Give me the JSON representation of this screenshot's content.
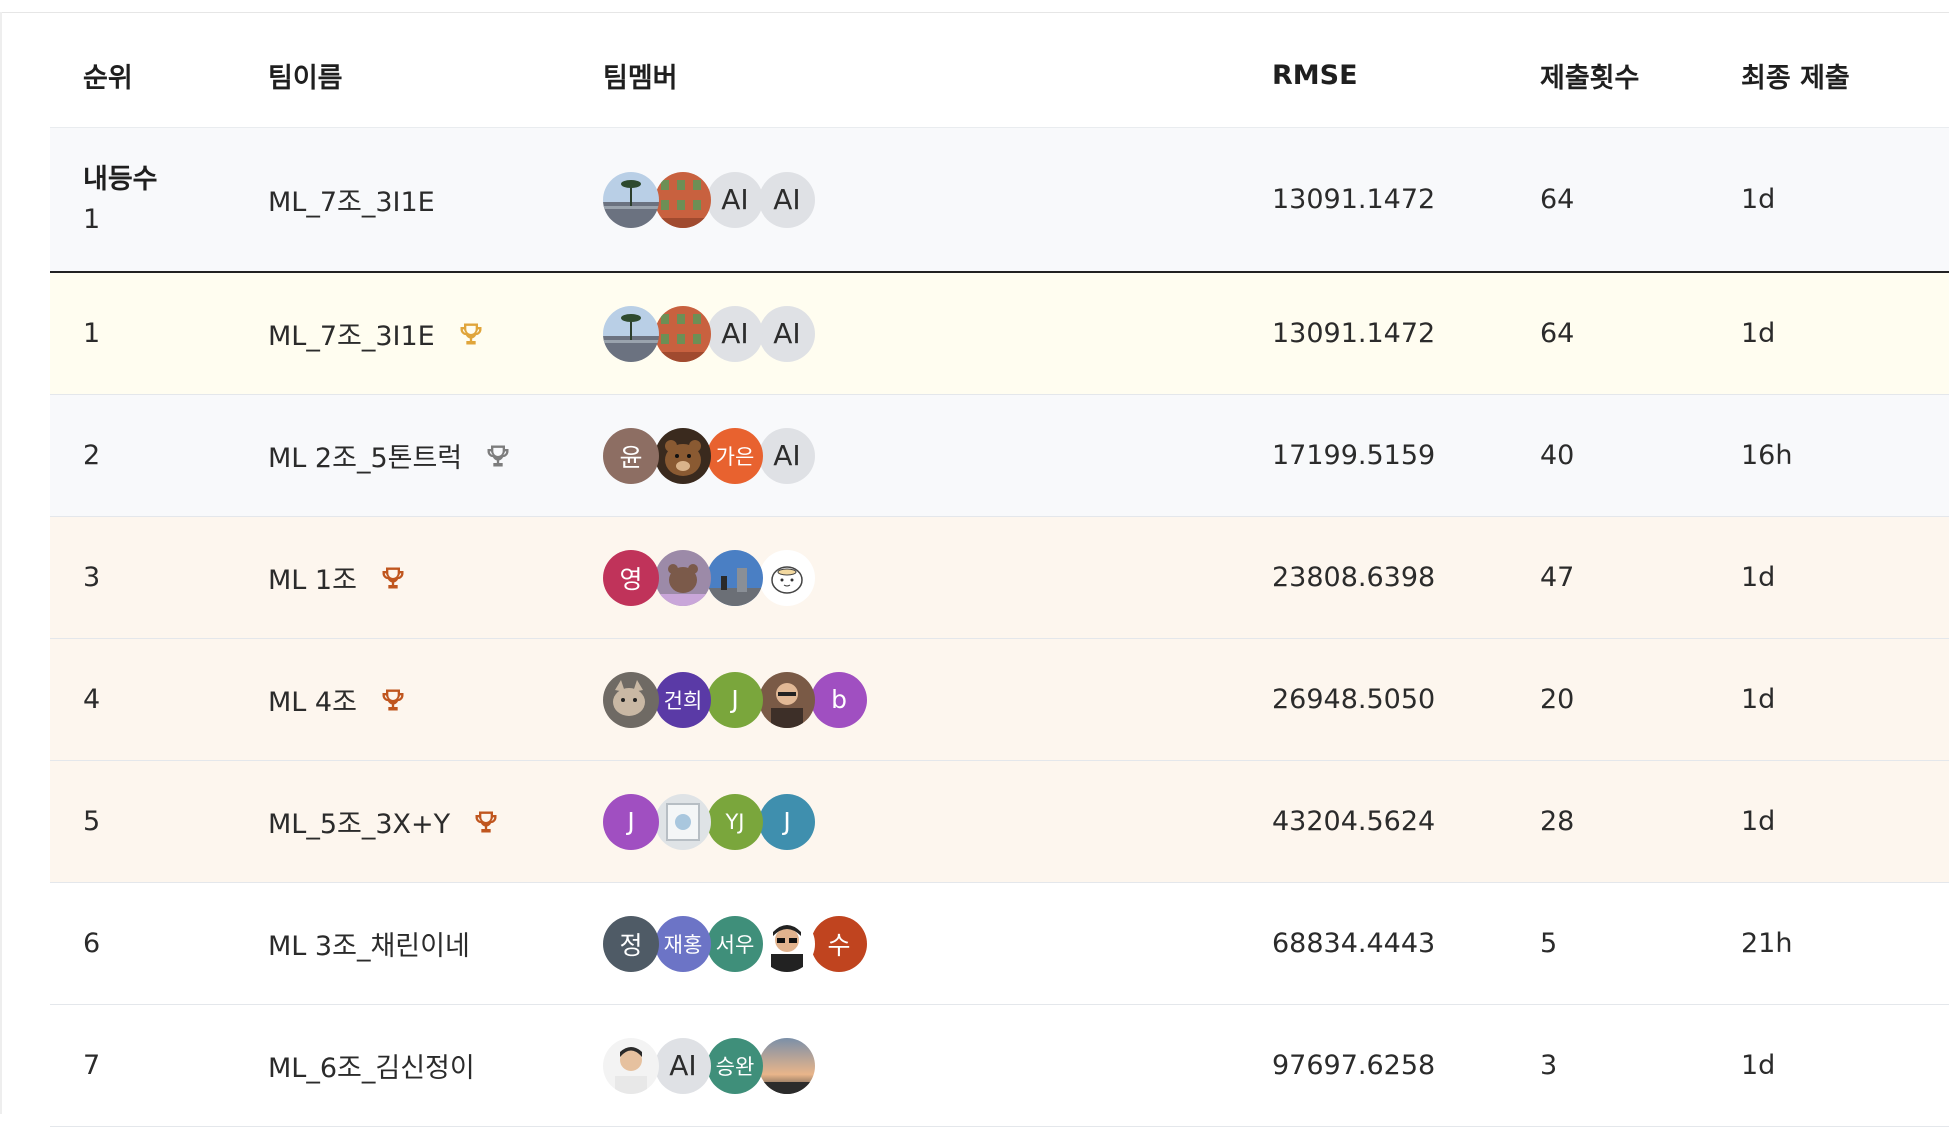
{
  "header": {
    "rank": "순위",
    "team": "팀이름",
    "members": "팀멤버",
    "score": "RMSE",
    "submissions": "제출횟수",
    "last": "최종 제출"
  },
  "my_team": {
    "label": "내등수",
    "rank": "1",
    "team": "ML_7조_3I1E",
    "score": "13091.1472",
    "submissions": "64",
    "last": "1d",
    "avatars": [
      {
        "text": "",
        "kind": "photo-palm"
      },
      {
        "text": "",
        "kind": "photo-building"
      },
      {
        "text": "AI",
        "kind": "text-gray"
      },
      {
        "text": "AI",
        "kind": "text-gray"
      }
    ]
  },
  "rows": [
    {
      "rank": "1",
      "team": "ML_7조_3I1E",
      "trophy": "gold",
      "trophy_color": "#e0a53b",
      "score": "13091.1472",
      "submissions": "64",
      "last": "1d",
      "bg": "#fffdf0",
      "avatars": [
        {
          "text": "",
          "kind": "photo-palm"
        },
        {
          "text": "",
          "kind": "photo-building"
        },
        {
          "text": "AI",
          "kind": "text-gray"
        },
        {
          "text": "AI",
          "kind": "text-gray"
        }
      ]
    },
    {
      "rank": "2",
      "team": "ML 2조_5톤트럭",
      "trophy": "silver",
      "trophy_color": "#7d7d7d",
      "score": "17199.5159",
      "submissions": "40",
      "last": "16h",
      "bg": "#f8f9fb",
      "avatars": [
        {
          "text": "윤",
          "kind": "color",
          "color": "#8d6e63"
        },
        {
          "text": "",
          "kind": "photo-bear"
        },
        {
          "text": "가은",
          "kind": "color",
          "color": "#e8622f"
        },
        {
          "text": "AI",
          "kind": "text-gray"
        }
      ]
    },
    {
      "rank": "3",
      "team": "ML 1조",
      "trophy": "bronze",
      "trophy_color": "#c0561f",
      "score": "23808.6398",
      "submissions": "47",
      "last": "1d",
      "bg": "#fdf6ee",
      "avatars": [
        {
          "text": "영",
          "kind": "color",
          "color": "#c0335a"
        },
        {
          "text": "",
          "kind": "photo-purple"
        },
        {
          "text": "",
          "kind": "photo-sky"
        },
        {
          "text": "",
          "kind": "photo-cartoon"
        }
      ]
    },
    {
      "rank": "4",
      "team": "ML 4조",
      "trophy": "bronze",
      "trophy_color": "#c0561f",
      "score": "26948.5050",
      "submissions": "20",
      "last": "1d",
      "bg": "#fdf6ee",
      "avatars": [
        {
          "text": "",
          "kind": "photo-cat"
        },
        {
          "text": "건희",
          "kind": "color",
          "color": "#5a3aa6"
        },
        {
          "text": "J",
          "kind": "color",
          "color": "#7aa63c"
        },
        {
          "text": "",
          "kind": "photo-person"
        },
        {
          "text": "b",
          "kind": "color",
          "color": "#a04fc1"
        }
      ]
    },
    {
      "rank": "5",
      "team": "ML_5조_3X+Y",
      "trophy": "bronze",
      "trophy_color": "#c0561f",
      "score": "43204.5624",
      "submissions": "28",
      "last": "1d",
      "bg": "#fdf6ee",
      "avatars": [
        {
          "text": "J",
          "kind": "color",
          "color": "#a04fc1"
        },
        {
          "text": "",
          "kind": "photo-frame"
        },
        {
          "text": "YJ",
          "kind": "color",
          "color": "#7aa63c"
        },
        {
          "text": "J",
          "kind": "color",
          "color": "#3f8fae"
        }
      ]
    },
    {
      "rank": "6",
      "team": "ML 3조_채린이네",
      "trophy": "",
      "trophy_color": "",
      "score": "68834.4443",
      "submissions": "5",
      "last": "21h",
      "bg": "#ffffff",
      "avatars": [
        {
          "text": "정",
          "kind": "color",
          "color": "#4f5b66"
        },
        {
          "text": "재홍",
          "kind": "color",
          "color": "#6c74c6"
        },
        {
          "text": "서우",
          "kind": "color",
          "color": "#3f8f7a"
        },
        {
          "text": "",
          "kind": "photo-glasses"
        },
        {
          "text": "수",
          "kind": "color",
          "color": "#c0441f"
        }
      ]
    },
    {
      "rank": "7",
      "team": "ML_6조_김신정이",
      "trophy": "",
      "trophy_color": "",
      "score": "97697.6258",
      "submissions": "3",
      "last": "1d",
      "bg": "#ffffff",
      "avatars": [
        {
          "text": "",
          "kind": "photo-man"
        },
        {
          "text": "AI",
          "kind": "text-gray"
        },
        {
          "text": "승완",
          "kind": "color",
          "color": "#3f8f7a"
        },
        {
          "text": "",
          "kind": "photo-sunset"
        }
      ]
    }
  ]
}
